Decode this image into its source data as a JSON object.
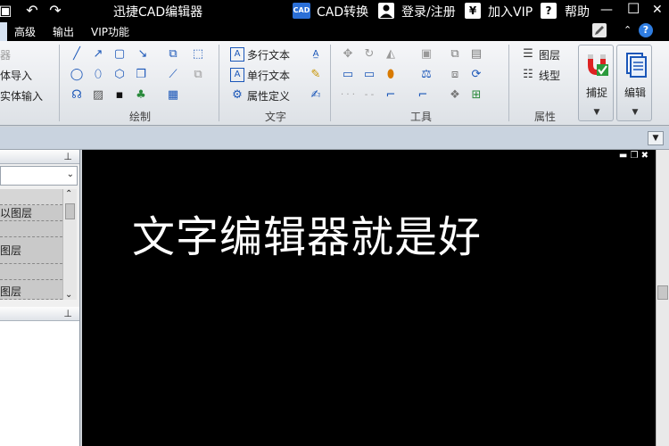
{
  "titlebar": {
    "app_title": "迅捷CAD编辑器",
    "cad_convert": "CAD转换",
    "login": "登录/注册",
    "vip": "加入VIP",
    "help": "帮助",
    "cad_badge": "CAD",
    "yen": "¥",
    "question": "?",
    "minimize": "—",
    "maximize": "☐",
    "close": "✕"
  },
  "tabs": [
    "高级",
    "输出",
    "VIP功能"
  ],
  "ribbon": {
    "left_partial": [
      "器",
      "体导入",
      "实体输入"
    ],
    "draw_group": "绘制",
    "text_group": {
      "label": "文字",
      "multiline": "多行文本",
      "singleline": "单行文本",
      "attr": "属性定义"
    },
    "tools_group": "工具",
    "props_group": {
      "label": "属性",
      "layer": "图层",
      "linetype": "线型"
    },
    "snap": "捕捉",
    "edit": "编辑"
  },
  "left_panel": {
    "layer_rows": [
      "以图层",
      "图层",
      "图层"
    ]
  },
  "canvas": {
    "text": "文字编辑器就是好"
  },
  "colors": {
    "canvas_bg": "#000000",
    "ribbon_accent": "#1a56b8"
  }
}
